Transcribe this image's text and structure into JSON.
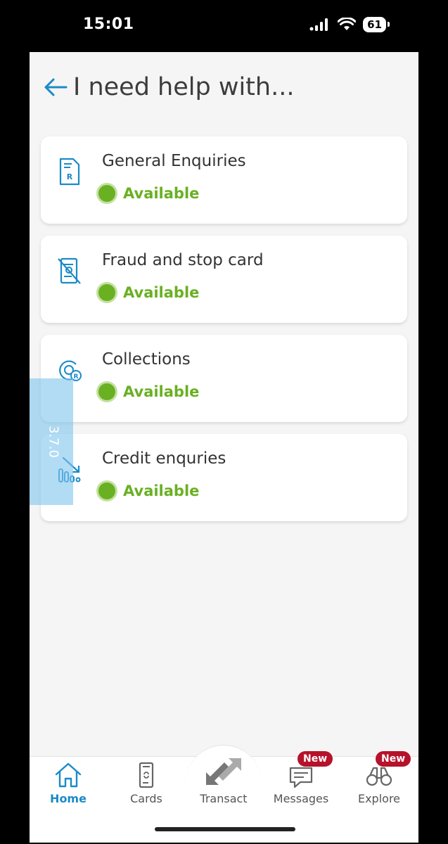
{
  "status_bar": {
    "time": "15:01",
    "battery": "61"
  },
  "header": {
    "title": "I need help with..."
  },
  "options": [
    {
      "title": "General Enquiries",
      "status": "Available",
      "icon": "document-r-icon"
    },
    {
      "title": "Fraud and stop card",
      "status": "Available",
      "icon": "card-stop-icon"
    },
    {
      "title": "Collections",
      "status": "Available",
      "icon": "collections-icon"
    },
    {
      "title": "Credit enquries",
      "status": "Available",
      "icon": "credit-chart-icon"
    }
  ],
  "version_overlay": "3.7.0",
  "nav": {
    "home": "Home",
    "cards": "Cards",
    "transact": "Transact",
    "messages": "Messages",
    "messages_badge": "New",
    "explore": "Explore",
    "explore_badge": "New"
  },
  "colors": {
    "accent": "#1a8ac8",
    "available": "#6ab023",
    "badge": "#b5122b"
  }
}
